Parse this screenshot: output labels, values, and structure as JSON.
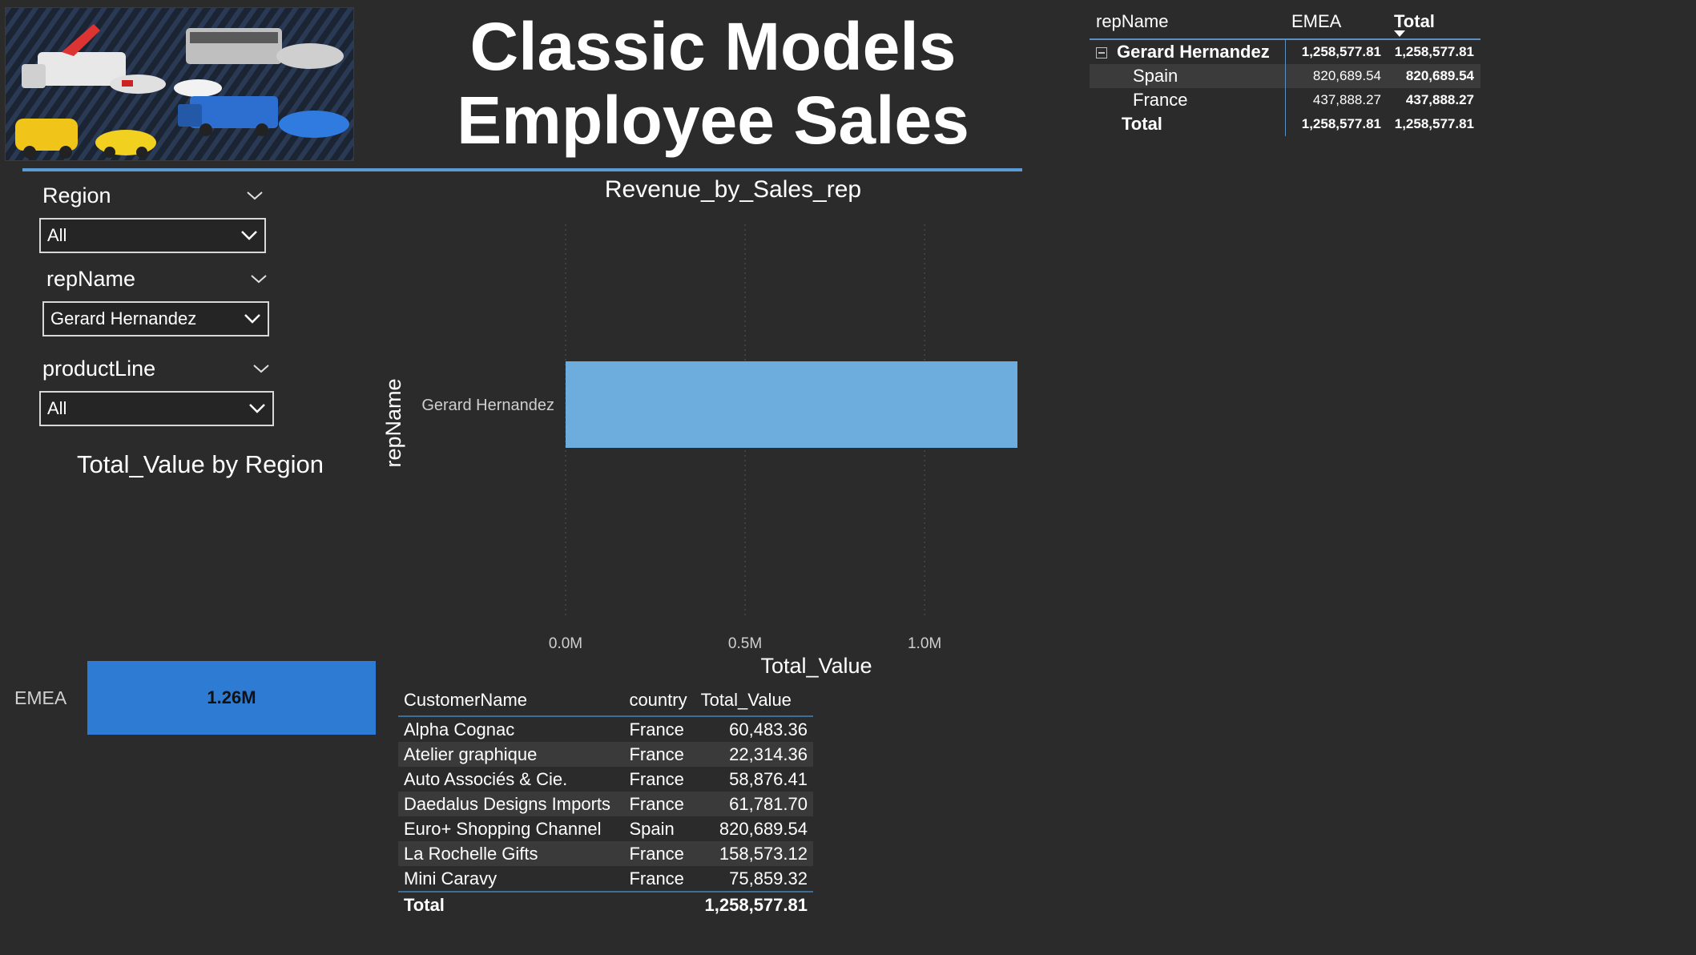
{
  "header": {
    "title_line1": "Classic Models",
    "title_line2": "Employee Sales"
  },
  "slicers": {
    "region": {
      "label": "Region",
      "value": "All"
    },
    "repName": {
      "label": "repName",
      "value": "Gerard Hernandez"
    },
    "productLine": {
      "label": "productLine",
      "value": "All"
    }
  },
  "region_chart": {
    "title": "Total_Value by Region",
    "category": "EMEA",
    "data_label": "1.26M"
  },
  "chart_data": {
    "type": "bar",
    "orientation": "horizontal",
    "title": "Revenue_by_Sales_rep",
    "categories": [
      "Gerard Hernandez"
    ],
    "values": [
      1258577.81
    ],
    "xlabel": "Total_Value",
    "ylabel": "repName",
    "xlim": [
      0,
      1258577.81
    ],
    "xticks": [
      0,
      500000,
      1000000
    ],
    "xtick_labels": [
      "0.0M",
      "0.5M",
      "1.0M"
    ],
    "grid": "vertical dotted",
    "bar_color": "#6cadde"
  },
  "customer_table": {
    "headers": [
      "CustomerName",
      "country",
      "Total_Value"
    ],
    "rows": [
      [
        "Alpha Cognac",
        "France",
        "60,483.36"
      ],
      [
        "Atelier graphique",
        "France",
        "22,314.36"
      ],
      [
        "Auto Associés & Cie.",
        "France",
        "58,876.41"
      ],
      [
        "Daedalus Designs Imports",
        "France",
        "61,781.70"
      ],
      [
        "Euro+ Shopping Channel",
        "Spain",
        "820,689.54"
      ],
      [
        "La Rochelle Gifts",
        "France",
        "158,573.12"
      ],
      [
        "Mini Caravy",
        "France",
        "75,859.32"
      ]
    ],
    "total_label": "Total",
    "total_value": "1,258,577.81"
  },
  "matrix": {
    "headers": [
      "repName",
      "EMEA",
      "Total"
    ],
    "rep": {
      "name": "Gerard Hernandez",
      "emea": "1,258,577.81",
      "total": "1,258,577.81"
    },
    "countries": [
      {
        "name": "Spain",
        "emea": "820,689.54",
        "total": "820,689.54"
      },
      {
        "name": "France",
        "emea": "437,888.27",
        "total": "437,888.27"
      }
    ],
    "total": {
      "label": "Total",
      "emea": "1,258,577.81",
      "total": "1,258,577.81"
    }
  },
  "colors": {
    "background": "#2b2b2b",
    "accent": "#5b9bd5",
    "region_bar": "#2e7bd3",
    "rep_bar": "#6cadde"
  }
}
